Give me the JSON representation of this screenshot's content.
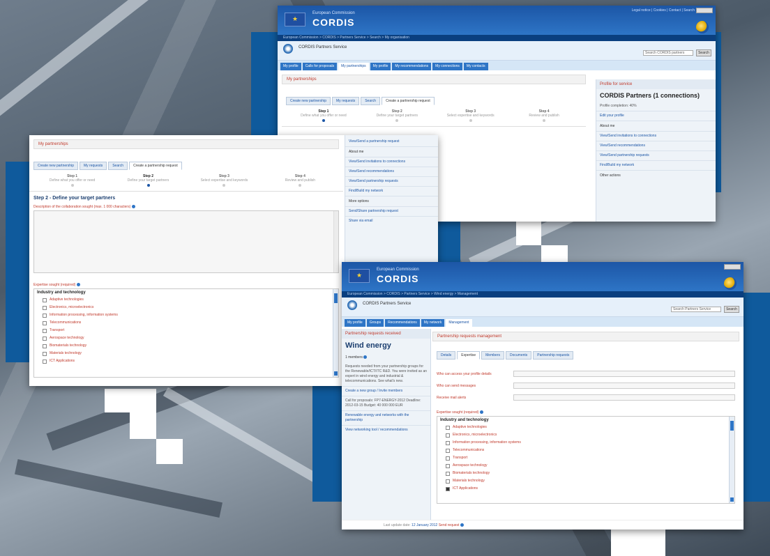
{
  "win1": {
    "header_sub": "European Commission",
    "header_title": "CORDIS",
    "header_links": "Legal notice | Cookies | Contact | Search",
    "topnav": "European Commission > CORDIS > Partners Service > Search > My organisation",
    "brand": "CORDIS Partners Service",
    "search_placeholder": "Search CORDIS partners",
    "search_button": "Search",
    "tabs": [
      "My profile",
      "Calls for proposals",
      "My partnerships",
      "My profile",
      "My recommendations",
      "My connections",
      "My contacts"
    ],
    "active_tab": 2,
    "crumb": "My partnerships",
    "subtabs": [
      "Create new partnership",
      "My requests",
      "Search",
      "Create a partnership request"
    ],
    "steps": [
      {
        "title": "Step 1",
        "sub": "Define what you offer or need"
      },
      {
        "title": "Step 2",
        "sub": "Define your target partners"
      },
      {
        "title": "Step 3",
        "sub": "Select expertise and keywords"
      },
      {
        "title": "Step 4",
        "sub": "Review and publish"
      }
    ],
    "sidebar": {
      "head": "Profile for service",
      "title": "CORDIS Partners (1 connections)",
      "text": "Profile completion: 40%",
      "link1": "Edit your profile",
      "cap": "About me",
      "links": [
        "View/Send invitations to connections",
        "View/Send recommendations",
        "View/Send partnership requests",
        "Find/Build my network"
      ],
      "cap2": "Other actions"
    }
  },
  "win2": {
    "crumb": "My partnerships",
    "subtabs": [
      "Create new partnership",
      "My requests",
      "Search",
      "Create a partnership request"
    ],
    "steps": [
      {
        "title": "Step 1",
        "sub": "Define what you offer or need"
      },
      {
        "title": "Step 2",
        "sub": "Define your target partners"
      },
      {
        "title": "Step 3",
        "sub": "Select expertise and keywords"
      },
      {
        "title": "Step 4",
        "sub": "Review and publish"
      }
    ],
    "heading": "Step 2 - Define your target partners",
    "desc_label": "Description of the collaboration sought (max. 1 000 characters)",
    "expertise_label": "Expertise sought (required)",
    "list_head": "Industry and technology",
    "list_items": [
      "Adaptive technologies",
      "Electronics, microelectronics",
      "Information processing, information systems",
      "Telecommunications",
      "Transport",
      "Aerospace technology",
      "Biomaterials technology",
      "Materials technology",
      "ICT Applications"
    ],
    "sidebar": {
      "link_top": "View/Send a partnership request",
      "cap": "About me",
      "links": [
        "View/Send invitations to connections",
        "View/Send recommendations",
        "View/Send partnership requests",
        "Find/Build my network"
      ],
      "cap2": "More options",
      "links2": [
        "Send/Share partnership request",
        "Share via email"
      ]
    }
  },
  "win3": {
    "header_sub": "European Commission",
    "header_title": "CORDIS",
    "topnav": "European Commission > CORDIS > Partners Service > Wind energy > Management",
    "brand": "CORDIS Partners Service",
    "search_placeholder": "Search Partners Service",
    "search_button": "Search",
    "tabs": [
      "My profile",
      "Groups",
      "Recommendations",
      "My network",
      "Management"
    ],
    "active_tab": 4,
    "left_crumb": "Partnership requests received",
    "group_title": "Wind energy",
    "section_label": "1 members",
    "left_text": "Requests needed from your partnership groups for the Renewable/ICT/ITC R&D. You were invited as an expert in wind energy and industrial & telecommunications. See what's new.",
    "left_link": "Create a new group / Invite members",
    "left_text2": "Call for proposals: FP7-ENERGY-2012 Deadline: 2012-03-15 Budget: 40 000 000 EUR",
    "left_links": [
      "Renewable energy and networks with the partnership",
      "View networking tool / recommendations"
    ],
    "main_crumb": "Partnership requests management",
    "subtabs": [
      "Details",
      "Expertise",
      "Members",
      "Documents",
      "Partnership requests"
    ],
    "active_subtab": 1,
    "rows": [
      "Who can access your profile details",
      "Who can send messages",
      "Receive mail alerts"
    ],
    "expertise_label": "Expertise sought (required)",
    "list_head": "Industry and technology",
    "list_items": [
      "Adaptive technologies",
      "Electronics, microelectronics",
      "Information processing, information systems",
      "Telecommunications",
      "Transport",
      "Aerospace technology",
      "Biomaterials technology",
      "Materials technology",
      "ICT Applications"
    ],
    "checked_index": 8,
    "bottom_prefix": "Last update date:",
    "bottom_link": "12 January 2012",
    "bottom_action": "Send request"
  },
  "colors": {
    "accent": "#2e75c6",
    "brand": "#1c56a6",
    "link_red": "#c0392b",
    "panel": "#0f5a9c"
  }
}
